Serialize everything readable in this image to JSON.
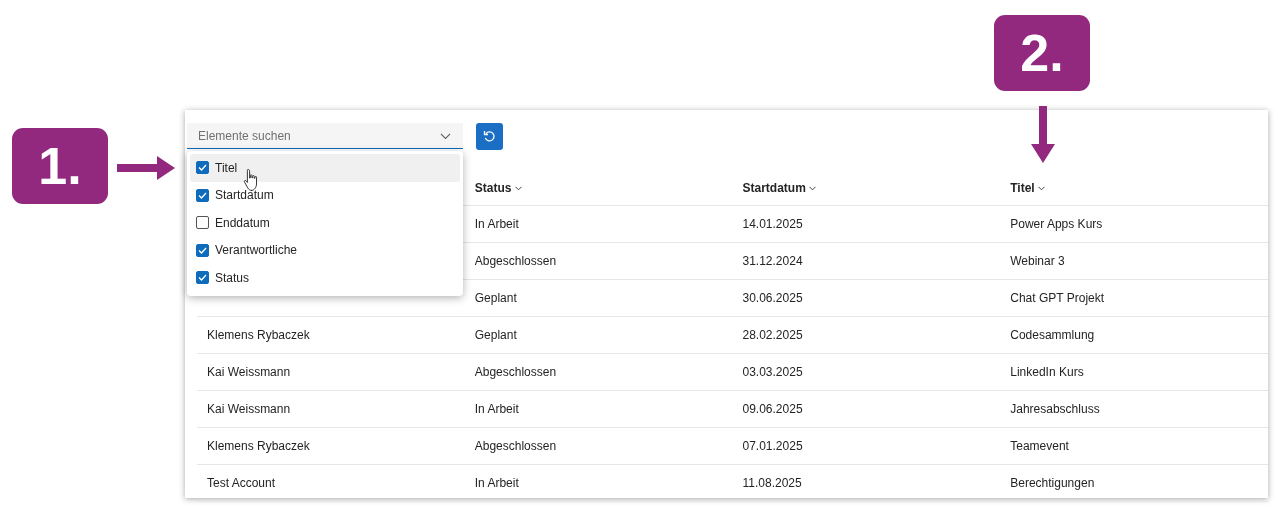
{
  "annotations": [
    {
      "label": "1."
    },
    {
      "label": "2."
    }
  ],
  "search": {
    "placeholder": "Elemente suchen"
  },
  "column_picker": [
    {
      "label": "Titel",
      "checked": true,
      "highlighted": true
    },
    {
      "label": "Startdatum",
      "checked": true,
      "highlighted": false
    },
    {
      "label": "Enddatum",
      "checked": false,
      "highlighted": false
    },
    {
      "label": "Verantwortliche",
      "checked": true,
      "highlighted": false
    },
    {
      "label": "Status",
      "checked": true,
      "highlighted": false
    }
  ],
  "table": {
    "columns": [
      "Status",
      "Startdatum",
      "Titel"
    ],
    "rows": [
      {
        "cells": [
          "In Arbeit",
          "14.01.2025",
          "Power Apps Kurs"
        ]
      },
      {
        "cells": [
          "Abgeschlossen",
          "31.12.2024",
          "Webinar 3"
        ]
      },
      {
        "cells": [
          "Geplant",
          "30.06.2025",
          "Chat GPT Projekt"
        ]
      },
      {
        "column_1": "Klemens Rybaczek",
        "cells": [
          "Geplant",
          "28.02.2025",
          "Codesammlung"
        ]
      },
      {
        "column_1": "Kai Weissmann",
        "cells": [
          "Abgeschlossen",
          "03.03.2025",
          "LinkedIn Kurs"
        ]
      },
      {
        "column_1": "Kai Weissmann",
        "cells": [
          "In Arbeit",
          "09.06.2025",
          "Jahresabschluss"
        ]
      },
      {
        "column_1": "Klemens Rybaczek",
        "cells": [
          "Abgeschlossen",
          "07.01.2025",
          "Teamevent"
        ]
      },
      {
        "column_1": "Test Account",
        "cells": [
          "In Arbeit",
          "11.08.2025",
          "Berechtigungen"
        ]
      }
    ]
  }
}
